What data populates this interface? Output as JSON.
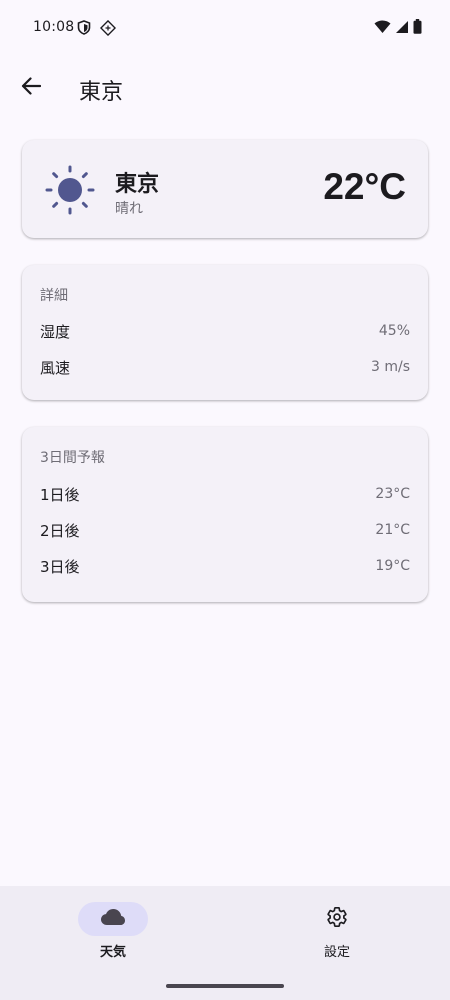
{
  "status_bar": {
    "time": "10:08",
    "icons": [
      "shield-icon",
      "diamond-icon",
      "wifi-icon",
      "signal-icon",
      "battery-icon"
    ]
  },
  "app_bar": {
    "title": "東京",
    "back_icon": "arrow-back-icon"
  },
  "current": {
    "icon": "sun-icon",
    "city": "東京",
    "condition": "晴れ",
    "temperature": "22°C"
  },
  "details": {
    "heading": "詳細",
    "rows": [
      {
        "label": "湿度",
        "value": "45%"
      },
      {
        "label": "風速",
        "value": "3 m/s"
      }
    ]
  },
  "forecast": {
    "heading": "3日間予報",
    "rows": [
      {
        "label": "1日後",
        "value": "23°C"
      },
      {
        "label": "2日後",
        "value": "21°C"
      },
      {
        "label": "3日後",
        "value": "19°C"
      }
    ]
  },
  "bottom_nav": {
    "items": [
      {
        "label": "天気",
        "icon": "cloud-icon",
        "selected": true
      },
      {
        "label": "設定",
        "icon": "gear-icon",
        "selected": false
      }
    ]
  },
  "colors": {
    "background": "#fbf8fe",
    "card": "#f4f1f8",
    "accent": "#51578f",
    "nav_indicator": "#dedcf8",
    "secondary_text": "#6f6d76"
  }
}
